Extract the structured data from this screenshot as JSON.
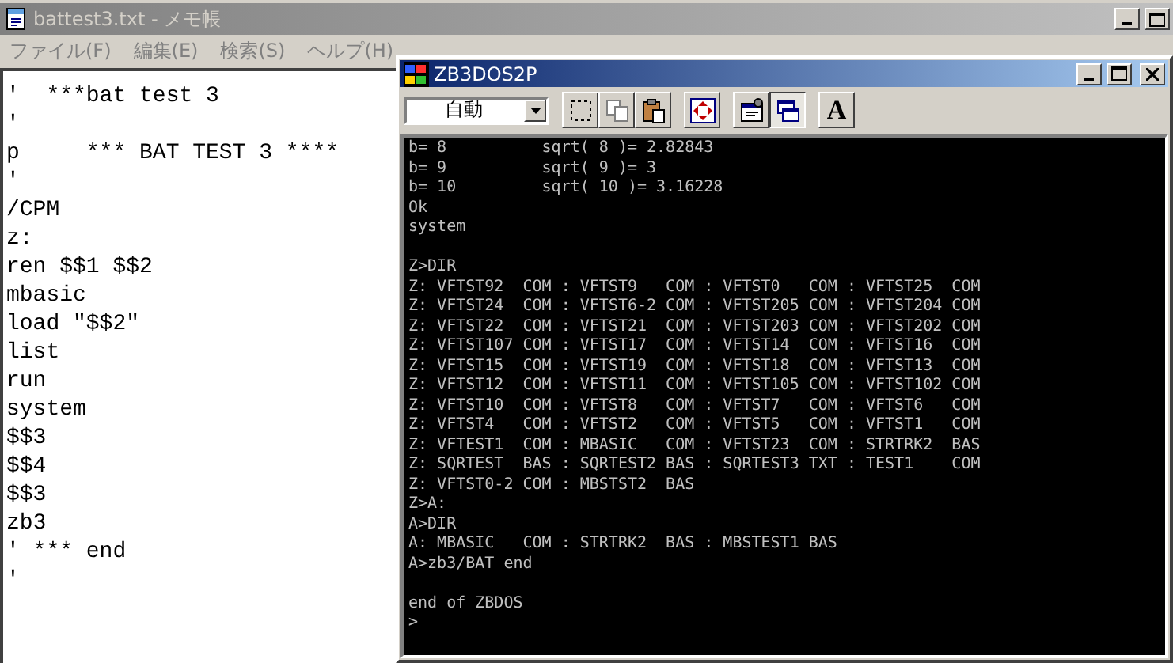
{
  "notepad": {
    "title": "battest3.txt - メモ帳",
    "active": false,
    "menu": [
      "ファイル(F)",
      "編集(E)",
      "検索(S)",
      "ヘルプ(H)"
    ],
    "lines": [
      "'  ***bat test 3",
      "'",
      "p     *** BAT TEST 3 ****",
      "'",
      "/CPM",
      "z:",
      "ren $$1 $$2",
      "mbasic",
      "load \"$$2\"",
      "list",
      "run",
      "system",
      "$$3",
      "$$4",
      "$$3",
      "zb3",
      "' *** end",
      "'"
    ]
  },
  "dos_window": {
    "title": "ZB3DOS2P",
    "active": true,
    "font_size": "自動",
    "toolbar": [
      {
        "kind": "mark",
        "disabled": false,
        "pressed": false
      },
      {
        "kind": "copy",
        "disabled": true,
        "pressed": false
      },
      {
        "kind": "paste",
        "disabled": false,
        "pressed": false
      },
      {
        "kind": "fullscreen",
        "disabled": false,
        "pressed": false
      },
      {
        "kind": "properties",
        "disabled": false,
        "pressed": false
      },
      {
        "kind": "background",
        "disabled": false,
        "pressed": true
      },
      {
        "kind": "font",
        "disabled": false,
        "pressed": false,
        "label": "A"
      }
    ],
    "console": [
      [
        "b= 8          sqrt( 8 )= 2.82843",
        "b= 9          sqrt( 9 )= 3",
        "b= 10         sqrt( 10 )= 3.16228",
        "Ok",
        "system"
      ],
      [
        "Z>DIR",
        "Z: VFTST92  COM : VFTST9   COM : VFTST0   COM : VFTST25  COM",
        "Z: VFTST24  COM : VFTST6-2 COM : VFTST205 COM : VFTST204 COM",
        "Z: VFTST22  COM : VFTST21  COM : VFTST203 COM : VFTST202 COM",
        "Z: VFTST107 COM : VFTST17  COM : VFTST14  COM : VFTST16  COM",
        "Z: VFTST15  COM : VFTST19  COM : VFTST18  COM : VFTST13  COM",
        "Z: VFTST12  COM : VFTST11  COM : VFTST105 COM : VFTST102 COM",
        "Z: VFTST10  COM : VFTST8   COM : VFTST7   COM : VFTST6   COM",
        "Z: VFTST4   COM : VFTST2   COM : VFTST5   COM : VFTST1   COM",
        "Z: VFTEST1  COM : MBASIC   COM : VFTST23  COM : STRTRK2  BAS",
        "Z: SQRTEST  BAS : SQRTEST2 BAS : SQRTEST3 TXT : TEST1    COM",
        "Z: VFTST0-2 COM : MBSTST2  BAS",
        "Z>A:",
        "A>DIR",
        "A: MBASIC   COM : STRTRK2  BAS : MBSTEST1 BAS",
        "A>zb3/BAT end"
      ],
      [
        "end of ZBDOS",
        ">"
      ]
    ]
  }
}
